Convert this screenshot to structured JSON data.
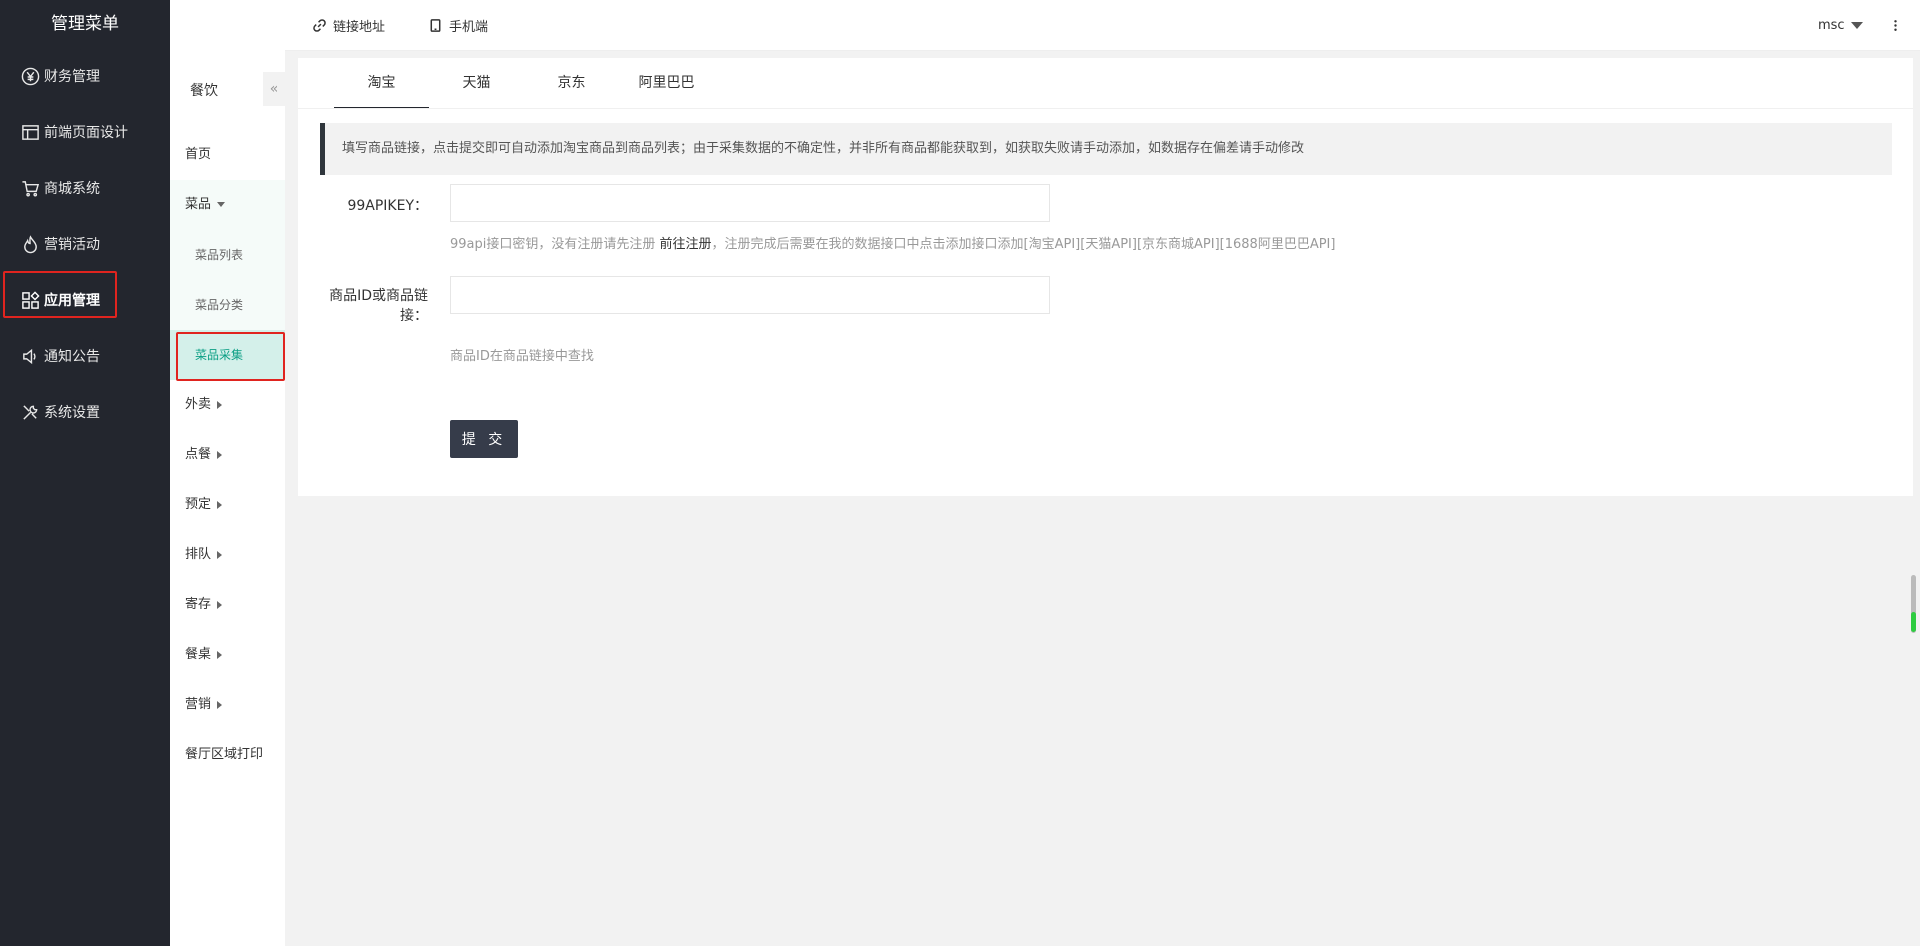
{
  "nav": {
    "title": "管理菜单",
    "items": [
      {
        "label": "财务管理",
        "icon": "yen-circle-icon"
      },
      {
        "label": "前端页面设计",
        "icon": "layout-icon"
      },
      {
        "label": "商城系统",
        "icon": "cart-icon"
      },
      {
        "label": "营销活动",
        "icon": "fire-icon"
      },
      {
        "label": "应用管理",
        "icon": "apps-icon",
        "active": true
      },
      {
        "label": "通知公告",
        "icon": "speaker-icon"
      },
      {
        "label": "系统设置",
        "icon": "tools-icon"
      }
    ]
  },
  "sub": {
    "title": "餐饮",
    "collapse": "«",
    "home": "首页",
    "dishes": {
      "label": "菜品",
      "children": [
        "菜品列表",
        "菜品分类",
        "菜品采集"
      ]
    },
    "groups": [
      "外卖",
      "点餐",
      "预定",
      "排队",
      "寄存",
      "餐桌",
      "营销"
    ],
    "print": "餐厅区域打印"
  },
  "top": {
    "link": "链接地址",
    "mobile": "手机端",
    "user": "msc"
  },
  "tabs": [
    "淘宝",
    "天猫",
    "京东",
    "阿里巴巴"
  ],
  "notice": "填写商品链接，点击提交即可自动添加淘宝商品到商品列表；由于采集数据的不确定性，并非所有商品都能获取到，如获取失败请手动添加，如数据存在偏差请手动修改",
  "form": {
    "apikey_label": "99APIKEY：",
    "apikey_value": "",
    "apikey_hint_pre": "99api接口密钥，没有注册请先注册 ",
    "apikey_hint_link": "前往注册",
    "apikey_hint_post": "，注册完成后需要在我的数据接口中点击添加接口添加[淘宝API][天猫API][京东商城API][1688阿里巴巴API]",
    "goods_label_1": "商品ID或商品链",
    "goods_label_2": "接：",
    "goods_value": "",
    "goods_hint": "商品ID在商品链接中查找",
    "submit": "提 交"
  },
  "colors": {
    "nav_bg": "#23262e",
    "highlight": "#e0241f",
    "sub_active_bg": "#d4f0ea",
    "sub_active_text": "#0c9f85",
    "button": "#363c4a"
  }
}
